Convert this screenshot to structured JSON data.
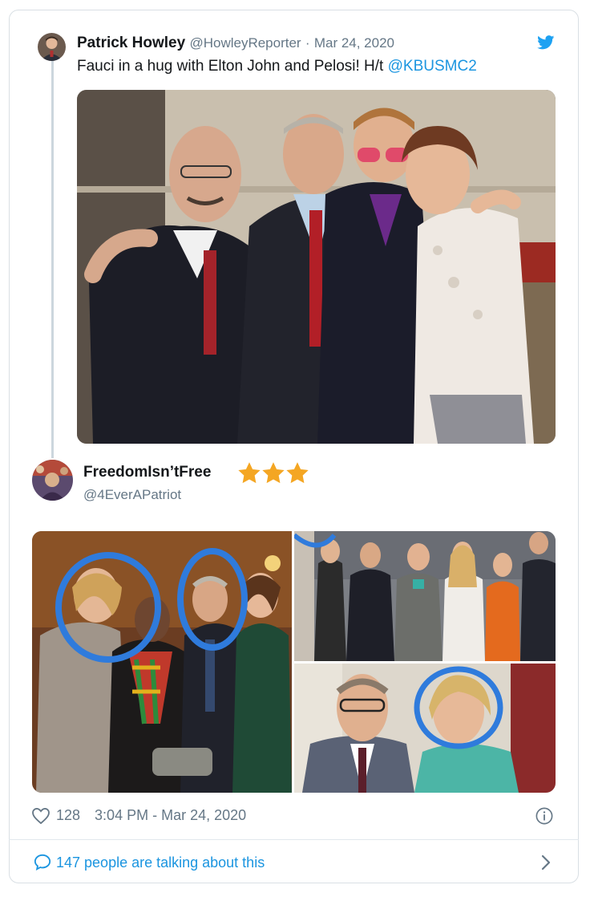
{
  "tweet1": {
    "author_name": "Patrick Howley",
    "handle": "@HowleyReporter",
    "separator": "·",
    "date": "Mar 24, 2020",
    "text": "Fauci in a hug with Elton John and Pelosi! H/t",
    "mention": "@KBUSMC2"
  },
  "tweet2": {
    "author_name": "FreedomIsn’tFree",
    "handle": "@4EverAPatriot",
    "stars_count": 3
  },
  "footer": {
    "likes": "128",
    "timestamp": "3:04 PM - Mar 24, 2020"
  },
  "talk": {
    "label": "147 people are talking about this"
  },
  "colors": {
    "accent": "#1b95e0",
    "twitter_blue": "#1da1f2",
    "star": "#f4a623",
    "text": "#14171a",
    "muted": "#657786"
  },
  "icons": [
    "twitter-bird-icon",
    "heart-icon",
    "info-icon",
    "comment-bubble-icon",
    "chevron-right-icon",
    "star-icon"
  ]
}
